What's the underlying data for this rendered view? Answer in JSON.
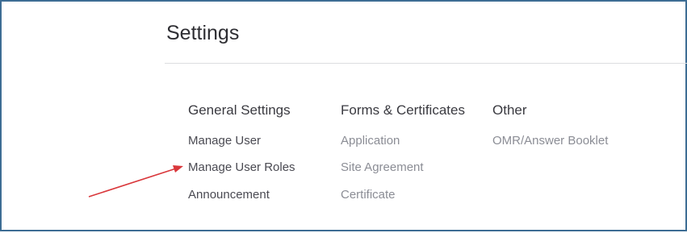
{
  "page": {
    "title": "Settings"
  },
  "columns": [
    {
      "heading": "General Settings",
      "items": [
        "Manage User",
        "Manage User Roles",
        "Announcement"
      ]
    },
    {
      "heading": "Forms & Certificates",
      "items": [
        "Application",
        "Site Agreement",
        "Certificate"
      ]
    },
    {
      "heading": "Other",
      "items": [
        "OMR/Answer Booklet"
      ]
    }
  ],
  "colors": {
    "frame_border": "#3d6d94",
    "annotation_arrow": "#d9373b"
  },
  "icons": {
    "annotation": "red-arrow-icon"
  }
}
